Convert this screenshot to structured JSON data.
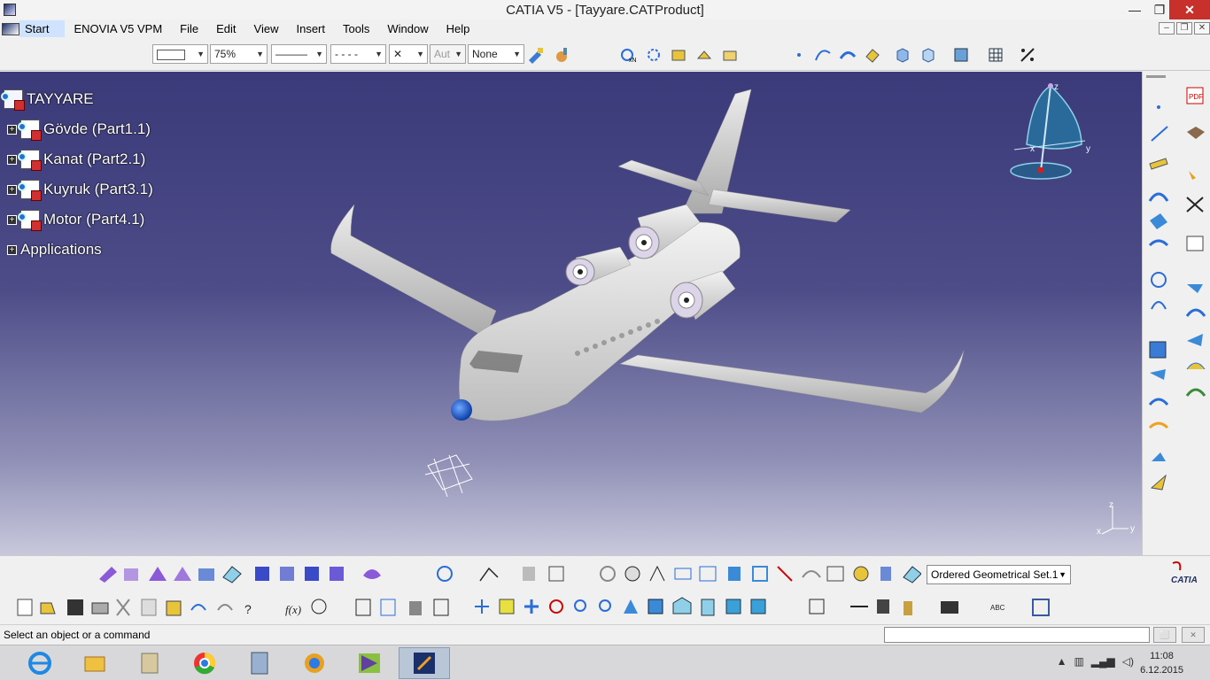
{
  "window": {
    "title": "CATIA V5 - [Tayyare.CATProduct]",
    "controls": {
      "minimize": "—",
      "maximize": "❐",
      "close": "✕"
    }
  },
  "menu": {
    "items": [
      "Start",
      "ENOVIA V5 VPM",
      "File",
      "Edit",
      "View",
      "Insert",
      "Tools",
      "Window",
      "Help"
    ],
    "mdi_controls": {
      "minimize": "–",
      "restore": "❐",
      "close": "✕"
    }
  },
  "toolbar": {
    "color_combo": "",
    "transparency_combo": "75%",
    "linetype_combo": "———",
    "dashtype_combo": "- - - -",
    "point_combo": "✕",
    "layer_combo": "Aut",
    "layer2_combo": "None"
  },
  "tree": {
    "root": "TAYYARE",
    "children": [
      {
        "label": "Gövde (Part1.1)"
      },
      {
        "label": "Kanat (Part2.1)"
      },
      {
        "label": "Kuyruk (Part3.1)"
      },
      {
        "label": "Motor (Part4.1)"
      }
    ],
    "applications": "Applications"
  },
  "compass": {
    "z": "z",
    "x": "x",
    "y": "y"
  },
  "axis_triad": {
    "z": "z",
    "x": "x",
    "y": "y"
  },
  "geometric_set": "Ordered Geometrical Set.1",
  "status": {
    "message": "Select an object or a command",
    "command_input": ""
  },
  "clock": {
    "time": "11:08",
    "date": "6.12.2015"
  },
  "brand": "CATIA",
  "colors": {
    "viewport_top": "#3b3a7a",
    "viewport_bottom": "#c8c8dc",
    "nose": "#1e5ad0",
    "body": "#e4e4e4"
  }
}
